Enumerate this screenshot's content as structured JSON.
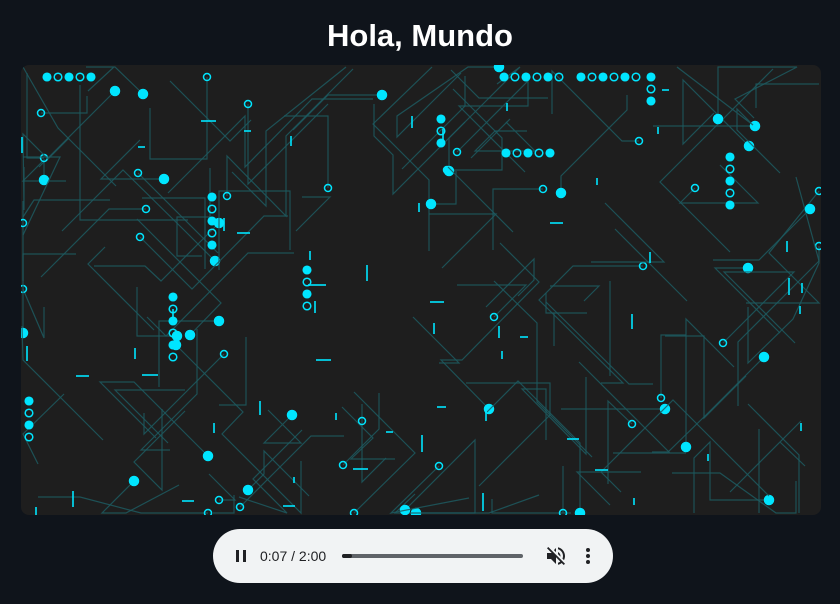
{
  "page": {
    "title": "Hola, Mundo"
  },
  "board": {
    "background_color": "#1e1e1e",
    "trace_color": "#1d5b60",
    "accent_color": "#00e5ff"
  },
  "player": {
    "state": "playing",
    "current_time": "0:07",
    "duration": "2:00",
    "time_label": "0:07 / 2:00",
    "progress": 0.058,
    "muted": true,
    "icons": [
      "pause-icon",
      "volume-off-icon",
      "more-vert-icon"
    ]
  }
}
